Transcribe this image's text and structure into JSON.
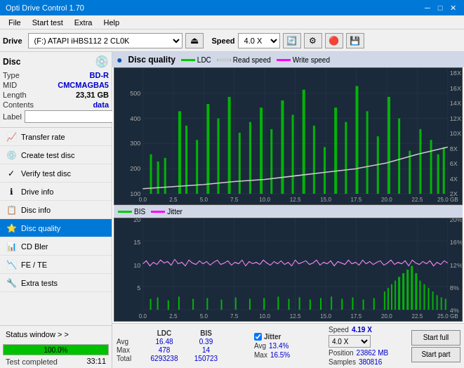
{
  "titlebar": {
    "title": "Opti Drive Control 1.70",
    "min_btn": "─",
    "max_btn": "□",
    "close_btn": "✕"
  },
  "menubar": {
    "items": [
      "File",
      "Start test",
      "Extra",
      "Help"
    ]
  },
  "toolbar": {
    "drive_label": "Drive",
    "drive_value": "(F:)  ATAPI iHBS112  2 CL0K",
    "speed_label": "Speed",
    "speed_value": "4.0 X"
  },
  "disc": {
    "label": "Disc",
    "type_key": "Type",
    "type_val": "BD-R",
    "mid_key": "MID",
    "mid_val": "CMCMAGBA5",
    "length_key": "Length",
    "length_val": "23,31 GB",
    "contents_key": "Contents",
    "contents_val": "data",
    "label_key": "Label",
    "label_placeholder": ""
  },
  "nav": {
    "items": [
      {
        "id": "transfer-rate",
        "label": "Transfer rate",
        "icon": "📈"
      },
      {
        "id": "create-test-disc",
        "label": "Create test disc",
        "icon": "💿"
      },
      {
        "id": "verify-test-disc",
        "label": "Verify test disc",
        "icon": "✓"
      },
      {
        "id": "drive-info",
        "label": "Drive info",
        "icon": "ℹ"
      },
      {
        "id": "disc-info",
        "label": "Disc info",
        "icon": "📋"
      },
      {
        "id": "disc-quality",
        "label": "Disc quality",
        "icon": "⭐",
        "active": true
      },
      {
        "id": "cd-bler",
        "label": "CD Bler",
        "icon": "📊"
      },
      {
        "id": "fe-te",
        "label": "FE / TE",
        "icon": "📉"
      },
      {
        "id": "extra-tests",
        "label": "Extra tests",
        "icon": "🔧"
      }
    ]
  },
  "status": {
    "status_window_label": "Status window > >",
    "status_text": "Test completed",
    "progress_pct": 100,
    "progress_label": "100.0%",
    "timer": "33:11"
  },
  "chart": {
    "title": "Disc quality",
    "legend": [
      {
        "id": "ldc",
        "label": "LDC",
        "color": "#00cc00"
      },
      {
        "id": "read-speed",
        "label": "Read speed",
        "color": "#ffffff"
      },
      {
        "id": "write-speed",
        "label": "Write speed",
        "color": "#ff00ff"
      }
    ],
    "legend2": [
      {
        "id": "bis",
        "label": "BIS",
        "color": "#00cc00"
      },
      {
        "id": "jitter",
        "label": "Jitter",
        "color": "#ff00ff"
      }
    ],
    "top_chart": {
      "y_max": 500,
      "y_labels": [
        "500",
        "400",
        "300",
        "200",
        "100"
      ],
      "y_labels_right": [
        "18X",
        "16X",
        "14X",
        "12X",
        "10X",
        "8X",
        "6X",
        "4X",
        "2X"
      ],
      "x_labels": [
        "0.0",
        "2.5",
        "5.0",
        "7.5",
        "10.0",
        "12.5",
        "15.0",
        "17.5",
        "20.0",
        "22.5",
        "25.0 GB"
      ]
    },
    "bottom_chart": {
      "y_max": 20,
      "y_labels": [
        "20",
        "15",
        "10",
        "5"
      ],
      "y_labels_right": [
        "20%",
        "16%",
        "12%",
        "8%",
        "4%"
      ],
      "x_labels": [
        "0.0",
        "2.5",
        "5.0",
        "7.5",
        "10.0",
        "12.5",
        "15.0",
        "17.5",
        "20.0",
        "22.5",
        "25.0 GB"
      ]
    }
  },
  "stats": {
    "ldc_label": "LDC",
    "bis_label": "BIS",
    "jitter_checkbox": true,
    "jitter_label": "Jitter",
    "speed_label": "Speed",
    "speed_val": "4.19 X",
    "speed_select": "4.0 X",
    "avg_label": "Avg",
    "avg_ldc": "16.48",
    "avg_bis": "0.39",
    "avg_jitter": "13.4%",
    "max_label": "Max",
    "max_ldc": "478",
    "max_bis": "14",
    "max_jitter": "16.5%",
    "total_label": "Total",
    "total_ldc": "6293238",
    "total_bis": "150723",
    "position_label": "Position",
    "position_val": "23862 MB",
    "samples_label": "Samples",
    "samples_val": "380816",
    "start_full_label": "Start full",
    "start_part_label": "Start part"
  }
}
